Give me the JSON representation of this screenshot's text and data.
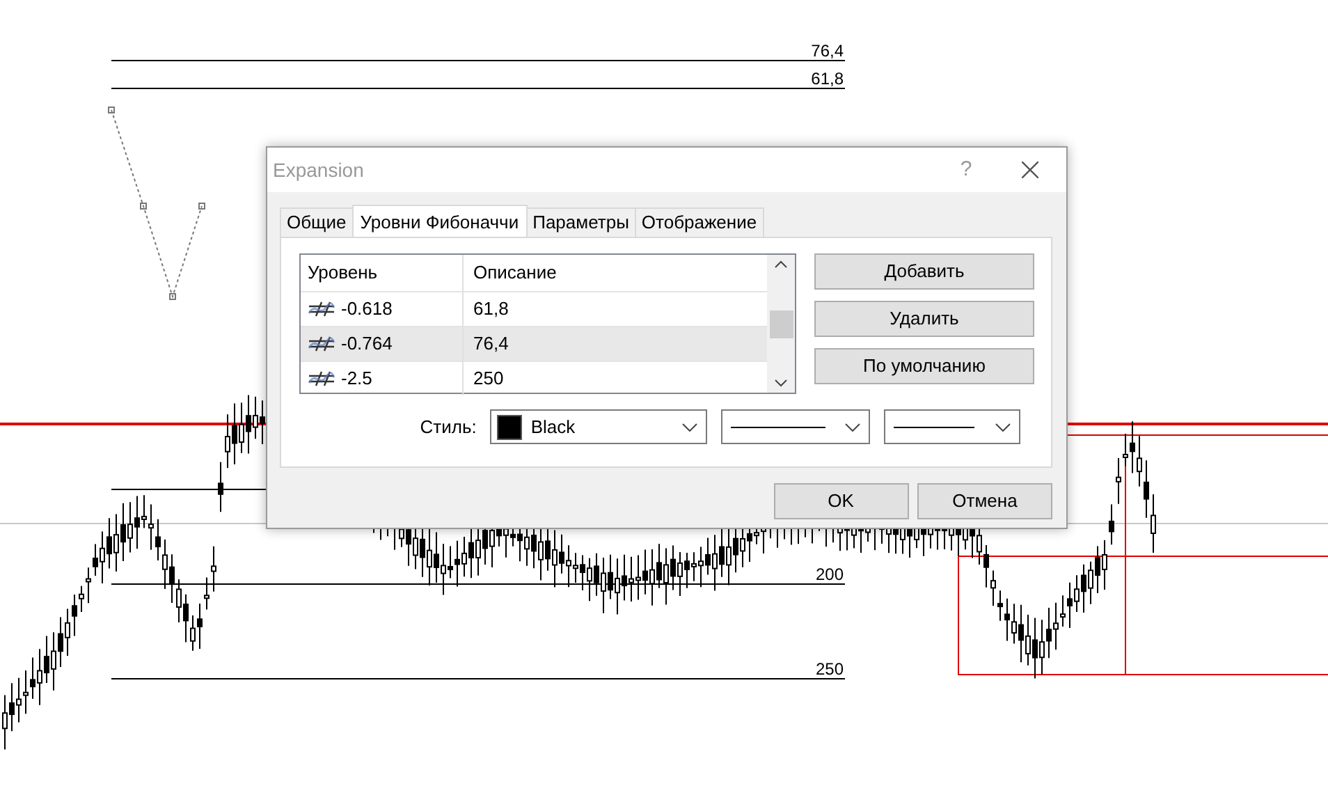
{
  "chart": {
    "levels": [
      {
        "label": "76,4"
      },
      {
        "label": "61,8"
      },
      {
        "label": "200"
      },
      {
        "label": "250"
      }
    ]
  },
  "dialog": {
    "title": "Expansion",
    "help": "?",
    "tabs": [
      {
        "label": "Общие",
        "selected": false
      },
      {
        "label": "Уровни Фибоначчи",
        "selected": true
      },
      {
        "label": "Параметры",
        "selected": false
      },
      {
        "label": "Отображение",
        "selected": false
      }
    ],
    "table": {
      "columns": [
        "Уровень",
        "Описание"
      ],
      "rows": [
        {
          "level": "-0.618",
          "description": "61,8",
          "selected": false
        },
        {
          "level": "-0.764",
          "description": "76,4",
          "selected": true
        },
        {
          "level": "-2.5",
          "description": "250",
          "selected": false
        }
      ]
    },
    "side_buttons": [
      "Добавить",
      "Удалить",
      "По умолчанию"
    ],
    "style": {
      "label": "Стиль:",
      "color_name": "Black",
      "color": "#000000"
    },
    "buttons": [
      "OK",
      "Отмена"
    ]
  }
}
